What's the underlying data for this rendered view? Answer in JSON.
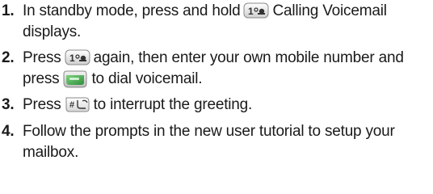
{
  "steps": [
    {
      "number": "1.",
      "parts": [
        "In standby mode, press and hold",
        "Calling Voicemail displays."
      ],
      "key_icons": [
        "one-voicemail-key-icon"
      ]
    },
    {
      "number": "2.",
      "parts": [
        "Press",
        "again, then enter your own mobile number and press",
        "to dial voicemail."
      ],
      "key_icons": [
        "one-voicemail-key-icon",
        "send-key-icon"
      ]
    },
    {
      "number": "3.",
      "parts": [
        "Press",
        "to interrupt the greeting."
      ],
      "key_icons": [
        "pound-key-icon"
      ]
    },
    {
      "number": "4.",
      "parts": [
        "Follow the prompts in the new user tutorial to setup your mailbox."
      ],
      "key_icons": []
    }
  ],
  "colors": {
    "text": "#1a1a1a",
    "key_border": "#8a8a8a",
    "send_green": "#3fae49"
  }
}
